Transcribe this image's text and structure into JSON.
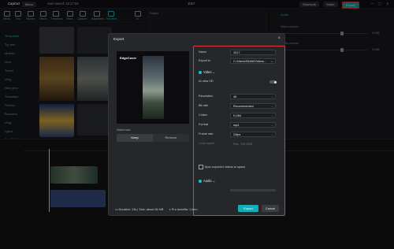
{
  "window": {
    "app_name": "CapCut",
    "menu_label": "Menu",
    "autosave_text": "Auto saved: 16:17:53",
    "project_title": "1017",
    "shortcuts_label": "Shortcuts",
    "share_label": "Share",
    "export_label": "Export"
  },
  "toolbar": {
    "tools": [
      "Media",
      "Text",
      "Stickers",
      "Effects",
      "Transitions",
      "Filters",
      "Captions",
      "Adjustment",
      "Templates",
      "AI"
    ],
    "active_index": 8
  },
  "left_nav": {
    "items": [
      "Templates",
      "Try this",
      "Movies",
      "Intro",
      "Travel",
      "Vlog",
      "New year",
      "Transition",
      "Fitness",
      "Business",
      "Vlog",
      "Lyrics",
      "For TikTok"
    ],
    "active_index": 0
  },
  "player": {
    "label": "Player"
  },
  "right_panel": {
    "tab": "Audio",
    "video_volume_label": "Video volume",
    "video_volume_value": "0.0dB",
    "audio_volume_label": "Audio volume",
    "audio_volume_value": "0.0dB"
  },
  "export_dialog": {
    "title": "Export",
    "preview_logo": "EdgeCover",
    "watermark_label": "Watermark",
    "keep_label": "Keep",
    "remove_label": "Remove",
    "name_label": "Name",
    "name_value": "1017",
    "export_to_label": "Export to",
    "export_to_value": "C:/Users/93446/Videos...",
    "video_section": "Video",
    "ai_ultra_hd_label": "AI ultra HD",
    "resolution_label": "Resolution",
    "resolution_value": "4K",
    "bitrate_label": "Bit rate",
    "bitrate_value": "Recommended",
    "codec_label": "Codec",
    "codec_value": "H.264",
    "format_label": "Format",
    "format_value": "mp4",
    "framerate_label": "Frame rate",
    "framerate_value": "24fps",
    "color_space_label": "Color space",
    "color_space_value": "Rec. 709 SDR",
    "sync_label": "Sync exported videos to space",
    "audio_section": "Audio",
    "duration_text": "Duration: 13s | Size: about 66 MB",
    "pro_benefits_text": "Pro benefits: 1 item",
    "export_button": "Export",
    "cancel_button": "Cancel"
  },
  "colors": {
    "accent": "#1bc4cf",
    "highlight": "#e23b3b",
    "dialog_bg": "#26272b"
  }
}
